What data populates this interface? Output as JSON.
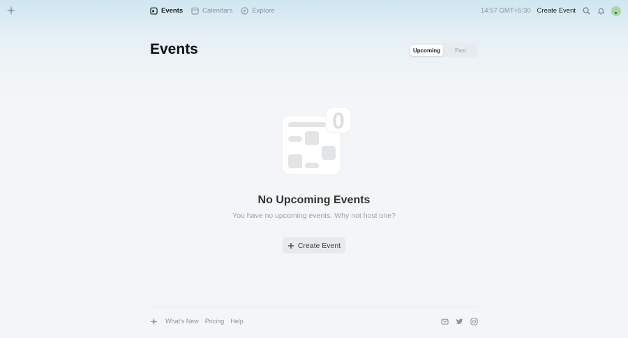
{
  "nav": {
    "items": [
      {
        "label": "Events",
        "icon": "events-icon",
        "active": true
      },
      {
        "label": "Calendars",
        "icon": "calendar-icon",
        "active": false
      },
      {
        "label": "Explore",
        "icon": "explore-compass-icon",
        "active": false
      }
    ]
  },
  "header": {
    "time": "14:57 GMT+5:30",
    "create_event": "Create Event"
  },
  "page": {
    "title": "Events",
    "tabs": [
      {
        "label": "Upcoming",
        "selected": true
      },
      {
        "label": "Past",
        "selected": false
      }
    ]
  },
  "empty_state": {
    "count": "0",
    "title": "No Upcoming Events",
    "subtitle": "You have no upcoming events. Why not host one?",
    "button_label": "Create Event"
  },
  "footer": {
    "links": [
      "What's New",
      "Pricing",
      "Help"
    ],
    "social_icons": [
      "mail-icon",
      "twitter-icon",
      "instagram-icon"
    ]
  },
  "colors": {
    "accent_text": "#1d1d1f",
    "muted_text": "#8a949c",
    "avatar": "#a9d9a2"
  }
}
